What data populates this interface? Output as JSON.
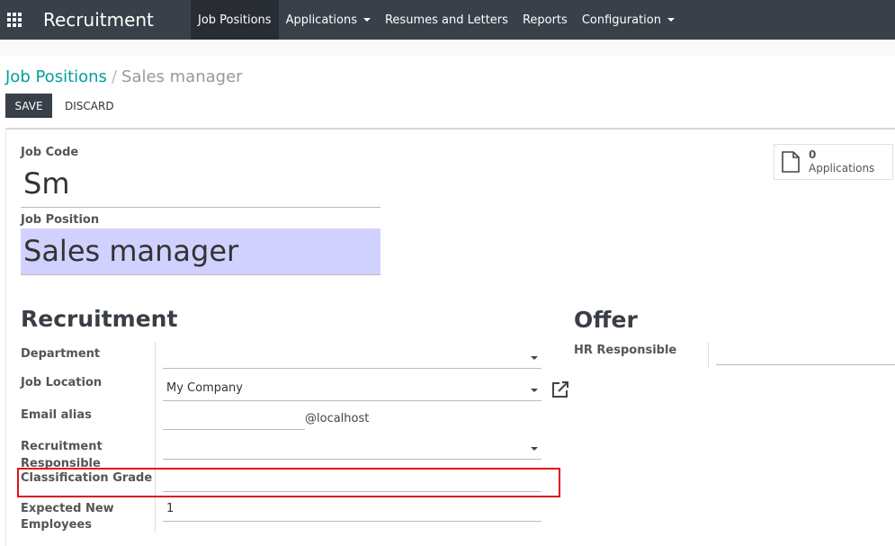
{
  "nav": {
    "brand": "Recruitment",
    "items": [
      {
        "label": "Job Positions",
        "active": true,
        "dropdown": false
      },
      {
        "label": "Applications",
        "active": false,
        "dropdown": true
      },
      {
        "label": "Resumes and Letters",
        "active": false,
        "dropdown": false
      },
      {
        "label": "Reports",
        "active": false,
        "dropdown": false
      },
      {
        "label": "Configuration",
        "active": false,
        "dropdown": true
      }
    ]
  },
  "breadcrumb": {
    "parent": "Job Positions",
    "separator": "/",
    "current": "Sales manager"
  },
  "actions": {
    "save": "SAVE",
    "discard": "DISCARD"
  },
  "smart_button": {
    "count": "0",
    "label": "Applications",
    "icon": "document-icon"
  },
  "form": {
    "job_code_label": "Job Code",
    "job_code_value": "Sm",
    "job_position_label": "Job Position",
    "job_position_value": "Sales manager",
    "recruitment_title": "Recruitment",
    "offer_title": "Offer",
    "department_label": "Department",
    "department_value": "",
    "job_location_label": "Job Location",
    "job_location_value": "My Company",
    "email_alias_label": "Email alias",
    "email_alias_value": "",
    "email_alias_domain": "@localhost",
    "recruitment_responsible_label_1": "Recruitment",
    "recruitment_responsible_label_2": "Responsible",
    "recruitment_responsible_value": "",
    "classification_grade_label": "Classification Grade",
    "classification_grade_value": "",
    "expected_employees_label_1": "Expected New",
    "expected_employees_label_2": "Employees",
    "expected_employees_value": "1",
    "hr_responsible_label": "HR Responsible",
    "hr_responsible_value": ""
  },
  "colors": {
    "navbar": "#394049",
    "accent": "#00a09d",
    "required_field_bg": "#d1d1ff",
    "highlight_border": "#e0131b"
  }
}
